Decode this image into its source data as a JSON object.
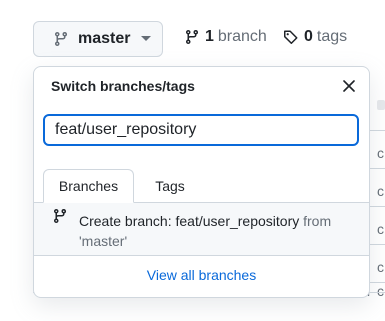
{
  "branch_selector": {
    "current_branch": "master",
    "branch_icon": "git-branch-icon",
    "caret_icon": "triangle-down-icon"
  },
  "meta": {
    "branches_count": "1",
    "branches_label": "branch",
    "branches_icon": "git-branch-icon",
    "tags_count": "0",
    "tags_label": "tags",
    "tags_icon": "tag-icon"
  },
  "dropdown": {
    "title": "Switch branches/tags",
    "close_icon": "x-icon",
    "filter_value": "feat/user_repository",
    "tabs": [
      {
        "label": "Branches",
        "selected": true
      },
      {
        "label": "Tags",
        "selected": false
      }
    ],
    "create_branch": {
      "prefix": "Create branch:",
      "name": "feat/user_repository",
      "from_text": "from",
      "source": "'master'",
      "icon": "git-branch-icon"
    },
    "view_all_label": "View all branches"
  },
  "background_rows": [
    "i",
    "c",
    "i",
    "c",
    "i",
    "c",
    "i",
    "c",
    "i",
    "c"
  ],
  "colors": {
    "accent": "#0969da",
    "border": "#d0d7de",
    "muted": "#656d76",
    "text": "#1f2328",
    "button_bg": "#f6f8fa"
  }
}
